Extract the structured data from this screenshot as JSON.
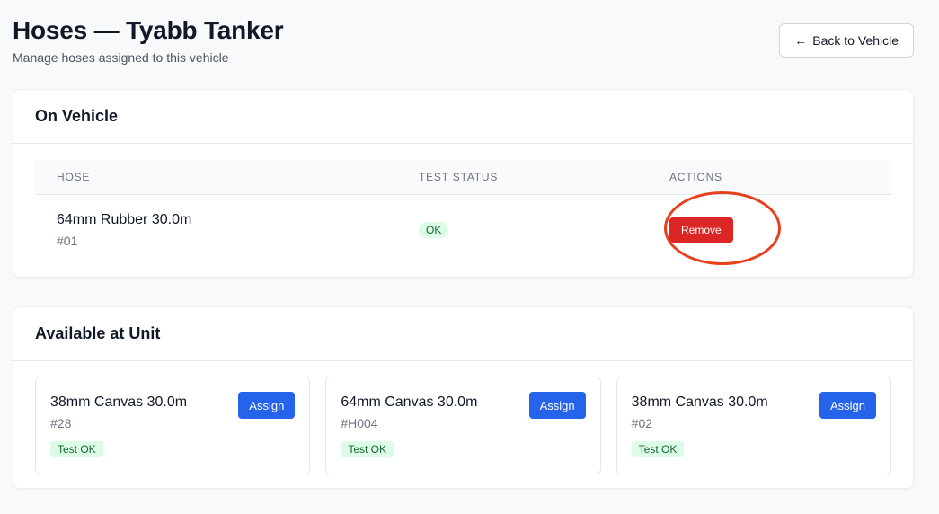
{
  "header": {
    "title": "Hoses — Tyabb Tanker",
    "subtitle": "Manage hoses assigned to this vehicle",
    "back_icon": "←",
    "back_label": "Back to Vehicle"
  },
  "on_vehicle": {
    "title": "On Vehicle",
    "columns": [
      "HOSE",
      "TEST STATUS",
      "ACTIONS"
    ],
    "rows": [
      {
        "name": "64mm Rubber 30.0m",
        "id": "#01",
        "status": "OK",
        "action": "Remove"
      }
    ]
  },
  "available": {
    "title": "Available at Unit",
    "assign_label": "Assign",
    "tiles": [
      {
        "name": "38mm Canvas 30.0m",
        "id": "#28",
        "badge": "Test OK"
      },
      {
        "name": "64mm Canvas 30.0m",
        "id": "#H004",
        "badge": "Test OK"
      },
      {
        "name": "38mm Canvas 30.0m",
        "id": "#02",
        "badge": "Test OK"
      }
    ]
  },
  "colors": {
    "danger": "#dc2626",
    "primary": "#2563eb",
    "success_bg": "#dcfce7",
    "success_text": "#166534",
    "annotation_ring": "#e8401c"
  }
}
